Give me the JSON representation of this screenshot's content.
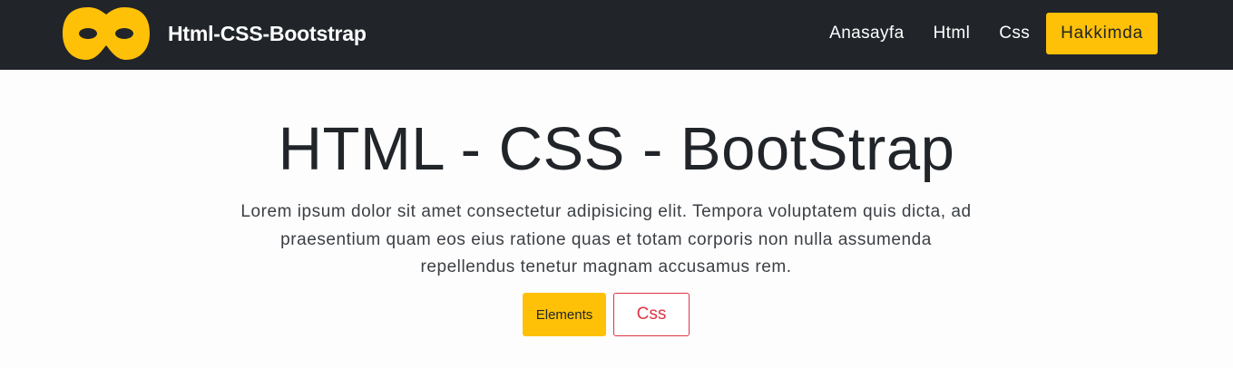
{
  "navbar": {
    "brand": {
      "logo_icon": "mask-icon",
      "text": "Html-CSS-Bootstrap"
    },
    "links": [
      {
        "label": "Anasayfa"
      },
      {
        "label": "Html"
      },
      {
        "label": "Css"
      },
      {
        "label": "Hakkimda",
        "active": true
      }
    ]
  },
  "hero": {
    "title": "HTML - CSS - BootStrap",
    "lead": "Lorem ipsum dolor sit amet consectetur adipisicing elit. Tempora voluptatem quis dicta, ad praesentium quam eos eius ratione quas et totam corporis non nulla assumenda repellendus tenetur magnam accusamus rem.",
    "buttons": {
      "primary_label": "Elements",
      "secondary_label": "Css"
    }
  },
  "colors": {
    "navbar_bg": "#212529",
    "accent": "#ffc107",
    "danger": "#dc3545",
    "text_dark": "#212529"
  }
}
